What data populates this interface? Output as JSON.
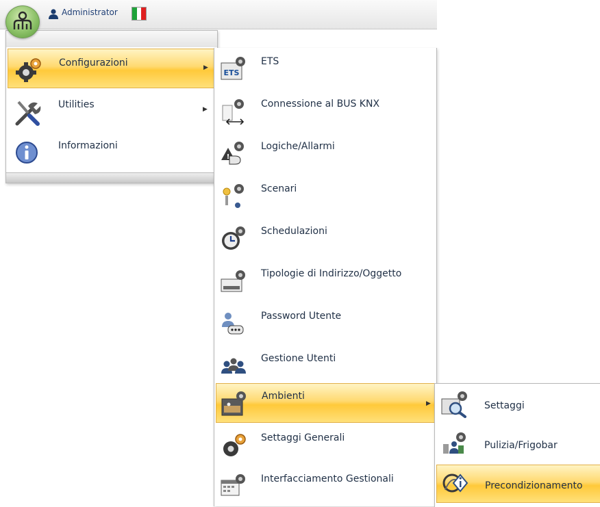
{
  "header": {
    "user_name": "Administrator",
    "user_icon": "user-icon",
    "flag_icon": "italian-flag-icon",
    "app_icon": "app-orb-icon"
  },
  "main_menu": {
    "items": [
      {
        "label": "Configurazioni",
        "icon": "gears-icon",
        "has_submenu": true,
        "highlighted": true
      },
      {
        "label": "Utilities",
        "icon": "tools-icon",
        "has_submenu": true,
        "highlighted": false
      },
      {
        "label": "Informazioni",
        "icon": "info-icon",
        "has_submenu": false,
        "highlighted": false
      }
    ]
  },
  "config_submenu": {
    "items": [
      {
        "label": "ETS",
        "icon": "ets-icon"
      },
      {
        "label": "Connessione al BUS KNX",
        "icon": "bus-connection-icon"
      },
      {
        "label": "Logiche/Allarmi",
        "icon": "logic-alarm-icon"
      },
      {
        "label": "Scenari",
        "icon": "scenes-icon"
      },
      {
        "label": "Schedulazioni",
        "icon": "clock-icon"
      },
      {
        "label": "Tipologie di Indirizzo/Oggetto",
        "icon": "address-type-icon"
      },
      {
        "label": "Password Utente",
        "icon": "user-password-icon"
      },
      {
        "label": "Gestione Utenti",
        "icon": "users-icon"
      },
      {
        "label": "Ambienti",
        "icon": "rooms-icon",
        "has_submenu": true,
        "highlighted": true
      },
      {
        "label": "Settaggi Generali",
        "icon": "general-settings-icon"
      },
      {
        "label": "Interfacciamento Gestionali",
        "icon": "calendar-interface-icon"
      }
    ]
  },
  "rooms_submenu": {
    "items": [
      {
        "label": "Settaggi",
        "icon": "settings-magnifier-icon"
      },
      {
        "label": "Pulizia/Frigobar",
        "icon": "cleaning-icon"
      },
      {
        "label": "Precondizionamento",
        "icon": "preconditioning-icon",
        "highlighted": true
      }
    ]
  },
  "colors": {
    "highlight": "#ffd970",
    "highlight_border": "#e2b048",
    "text": "#1f2f45",
    "username_text": "#1f3f75"
  }
}
